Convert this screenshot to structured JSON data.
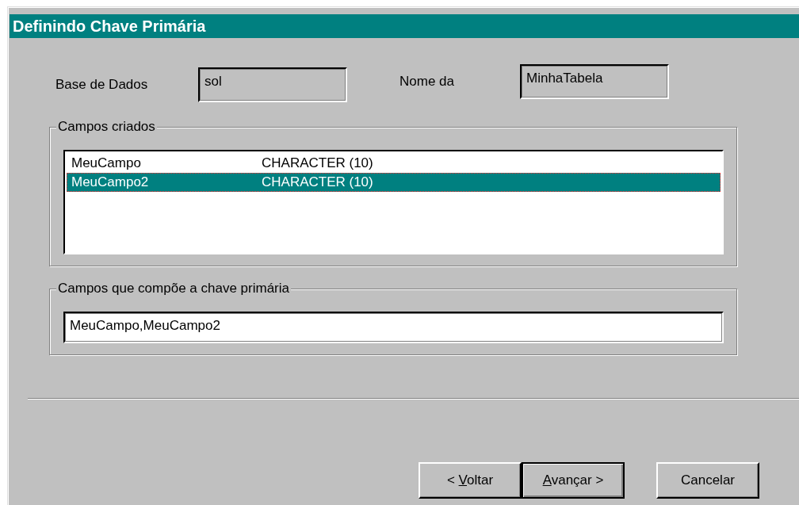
{
  "window": {
    "title": "Definindo Chave Primária"
  },
  "fields": [
    {
      "label": "Base de Dados",
      "value": "sol"
    },
    {
      "label": "Nome da",
      "value": "MinhaTabela"
    }
  ],
  "created_fields": {
    "title": "Campos criados",
    "rows": [
      {
        "name": "MeuCampo",
        "type": "CHARACTER (10)",
        "selected": false
      },
      {
        "name": "MeuCampo2",
        "type": "CHARACTER (10)",
        "selected": true
      }
    ]
  },
  "primary_key": {
    "title": "Campos que compõe a chave primária",
    "value": "MeuCampo,MeuCampo2"
  },
  "buttons": [
    {
      "before": "< ",
      "key": "V",
      "after": "oltar",
      "default": false
    },
    {
      "key": "A",
      "after": "vançar >",
      "default": true
    },
    {
      "before": "Cancelar",
      "default": false
    }
  ]
}
